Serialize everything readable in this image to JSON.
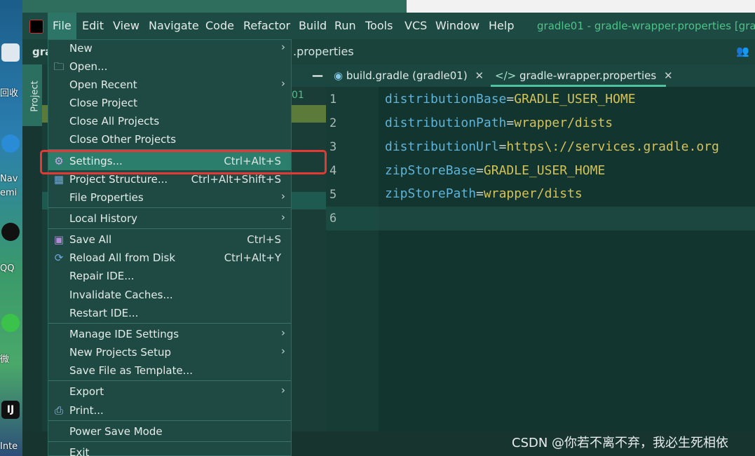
{
  "desktop": {
    "labels": [
      "回收",
      "Nav",
      "emi",
      "QQ",
      "微",
      "IJ",
      "Inte"
    ]
  },
  "menubar": {
    "items": [
      "File",
      "Edit",
      "View",
      "Navigate",
      "Code",
      "Refactor",
      "Build",
      "Run",
      "Tools",
      "VCS",
      "Window",
      "Help"
    ],
    "title": "gradle01 - gradle-wrapper.properties [grac"
  },
  "navbar": {
    "project": "gra",
    "file": ".properties"
  },
  "tool_window": {
    "project_label": "Project",
    "partial_line": "01"
  },
  "editor": {
    "tabs": [
      {
        "label": "build.gradle (gradle01)",
        "icon": "gradle-elephant-icon"
      },
      {
        "label": "gradle-wrapper.properties",
        "icon": "code-tag-icon"
      }
    ],
    "lines": [
      {
        "num": "1",
        "key": "distributionBase",
        "value": "GRADLE_USER_HOME"
      },
      {
        "num": "2",
        "key": "distributionPath",
        "value": "wrapper/dists"
      },
      {
        "num": "3",
        "key": "distributionUrl",
        "value": "https\\://services.gradle.org"
      },
      {
        "num": "4",
        "key": "zipStoreBase",
        "value": "GRADLE_USER_HOME"
      },
      {
        "num": "5",
        "key": "zipStorePath",
        "value": "wrapper/dists"
      },
      {
        "num": "6",
        "key": "",
        "value": ""
      }
    ]
  },
  "file_menu": {
    "items": [
      {
        "label": "New",
        "shortcut": "",
        "submenu": true
      },
      {
        "label": "Open...",
        "shortcut": "",
        "submenu": false,
        "icon": "folder-icon"
      },
      {
        "label": "Open Recent",
        "shortcut": "",
        "submenu": true
      },
      {
        "label": "Close Project",
        "shortcut": "",
        "submenu": false
      },
      {
        "label": "Close All Projects",
        "shortcut": "",
        "submenu": false
      },
      {
        "label": "Close Other Projects",
        "shortcut": "",
        "submenu": false
      },
      {
        "label": "Settings...",
        "shortcut": "Ctrl+Alt+S",
        "submenu": false,
        "icon": "gear-icon"
      },
      {
        "label": "Project Structure...",
        "shortcut": "Ctrl+Alt+Shift+S",
        "submenu": false,
        "icon": "project-structure-icon"
      },
      {
        "label": "File Properties",
        "shortcut": "",
        "submenu": true
      },
      {
        "label": "Local History",
        "shortcut": "",
        "submenu": true
      },
      {
        "label": "Save All",
        "shortcut": "Ctrl+S",
        "submenu": false,
        "icon": "save-icon"
      },
      {
        "label": "Reload All from Disk",
        "shortcut": "Ctrl+Alt+Y",
        "submenu": false,
        "icon": "reload-icon"
      },
      {
        "label": "Repair IDE...",
        "shortcut": "",
        "submenu": false
      },
      {
        "label": "Invalidate Caches...",
        "shortcut": "",
        "submenu": false
      },
      {
        "label": "Restart IDE...",
        "shortcut": "",
        "submenu": false
      },
      {
        "label": "Manage IDE Settings",
        "shortcut": "",
        "submenu": true
      },
      {
        "label": "New Projects Setup",
        "shortcut": "",
        "submenu": true
      },
      {
        "label": "Save File as Template...",
        "shortcut": "",
        "submenu": false
      },
      {
        "label": "Export",
        "shortcut": "",
        "submenu": true
      },
      {
        "label": "Print...",
        "shortcut": "",
        "submenu": false,
        "icon": "print-icon"
      },
      {
        "label": "Power Save Mode",
        "shortcut": "",
        "submenu": false
      },
      {
        "label": "Exit",
        "shortcut": "",
        "submenu": false
      }
    ],
    "arrow_glyph": "›"
  },
  "watermark": "CSDN @你若不离不弃，我必生死相依",
  "colors": {
    "accent": "#2b7d6c",
    "highlight_box": "#e53935",
    "key_color": "#5fb3d8",
    "value_color": "#d4c25a"
  }
}
